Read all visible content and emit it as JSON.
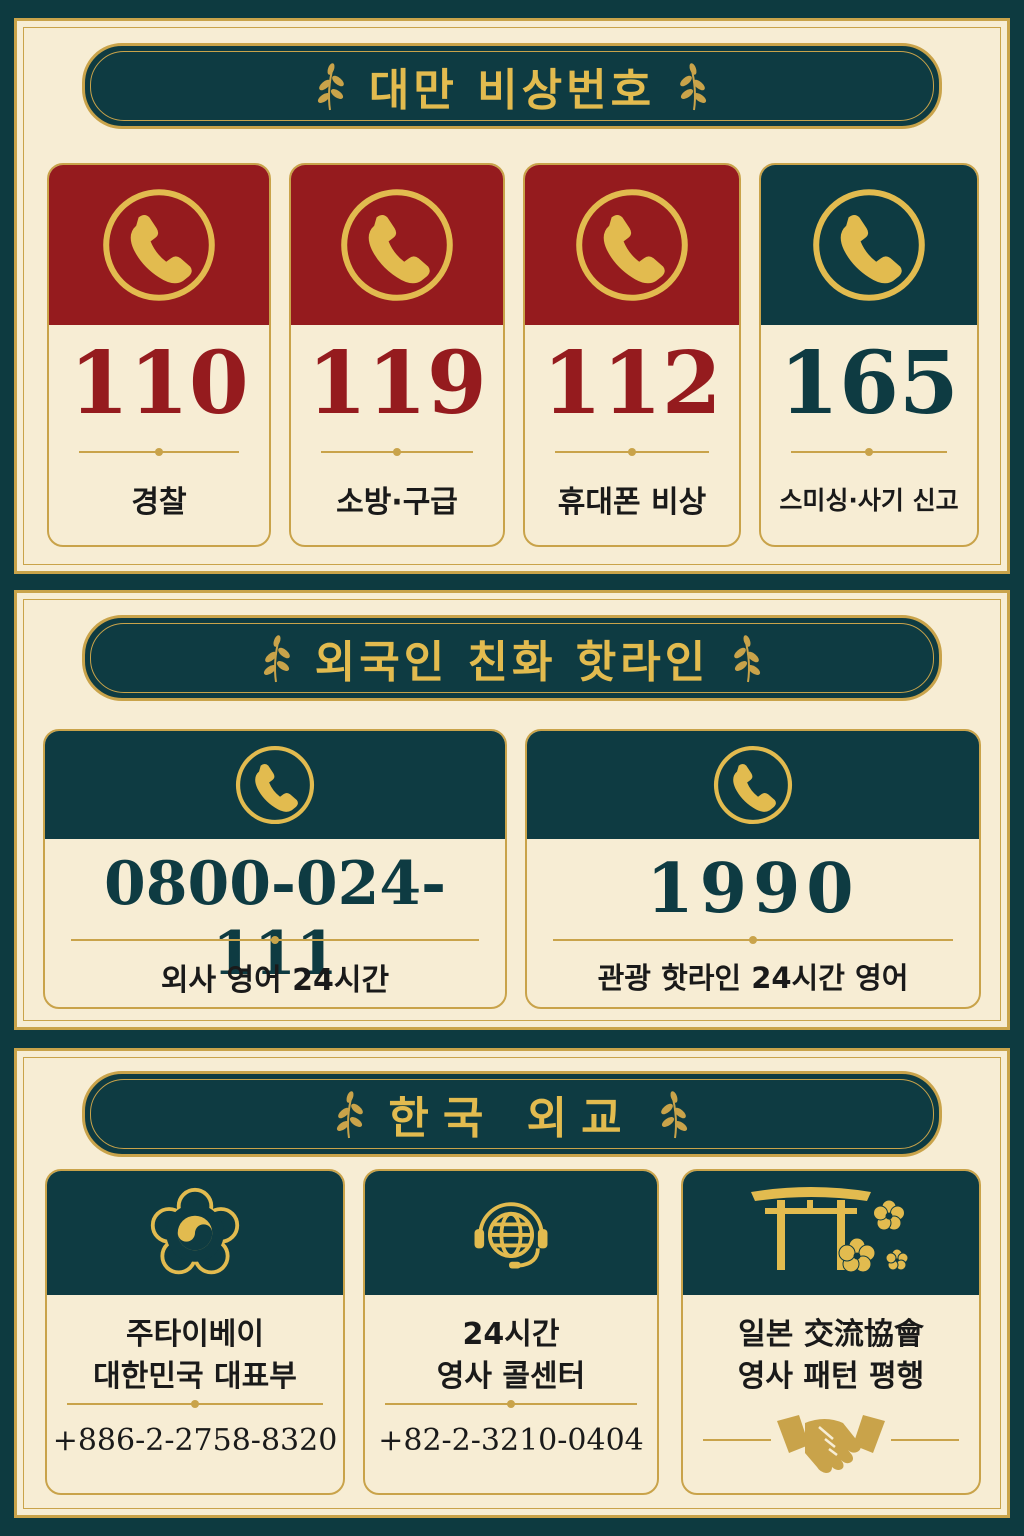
{
  "sections": {
    "taiwan": {
      "title": "대만 비상번호",
      "cards": [
        {
          "number": "110",
          "label": "경찰",
          "theme": "red",
          "icon": "phone-icon"
        },
        {
          "number": "119",
          "label": "소방·구급",
          "theme": "red",
          "icon": "phone-icon"
        },
        {
          "number": "112",
          "label": "휴대폰 비상",
          "theme": "red",
          "icon": "phone-icon"
        },
        {
          "number": "165",
          "label": "스미싱·사기 신고",
          "theme": "teal",
          "icon": "phone-icon"
        }
      ]
    },
    "foreigner": {
      "title": "외국인 친화 핫라인",
      "cards": [
        {
          "number": "0800-024-111",
          "label": "외사 영어 24시간",
          "icon": "phone-icon"
        },
        {
          "number": "1990",
          "label": "관광 핫라인 24시간 영어",
          "icon": "phone-icon"
        }
      ]
    },
    "korea": {
      "title": "한국 외교",
      "cards": [
        {
          "line1": "주타이베이",
          "line2": "대한민국 대표부",
          "phone": "+886-2-2758-8320",
          "icon": "mugunghwa-emblem-icon"
        },
        {
          "line1": "24시간",
          "line2": "영사 콜센터",
          "phone": "+82-2-3210-0404",
          "icon": "globe-headset-icon"
        },
        {
          "line1": "일본 交流協會",
          "line2": "영사 패턴 평행",
          "icon": "torii-sakura-icon",
          "footer_icon": "handshake-icon"
        }
      ]
    }
  },
  "colors": {
    "background": "#0d3a40",
    "cream": "#f7edd4",
    "gold": "#c9a34a",
    "red": "#951b1e",
    "teal": "#0e3b42"
  }
}
